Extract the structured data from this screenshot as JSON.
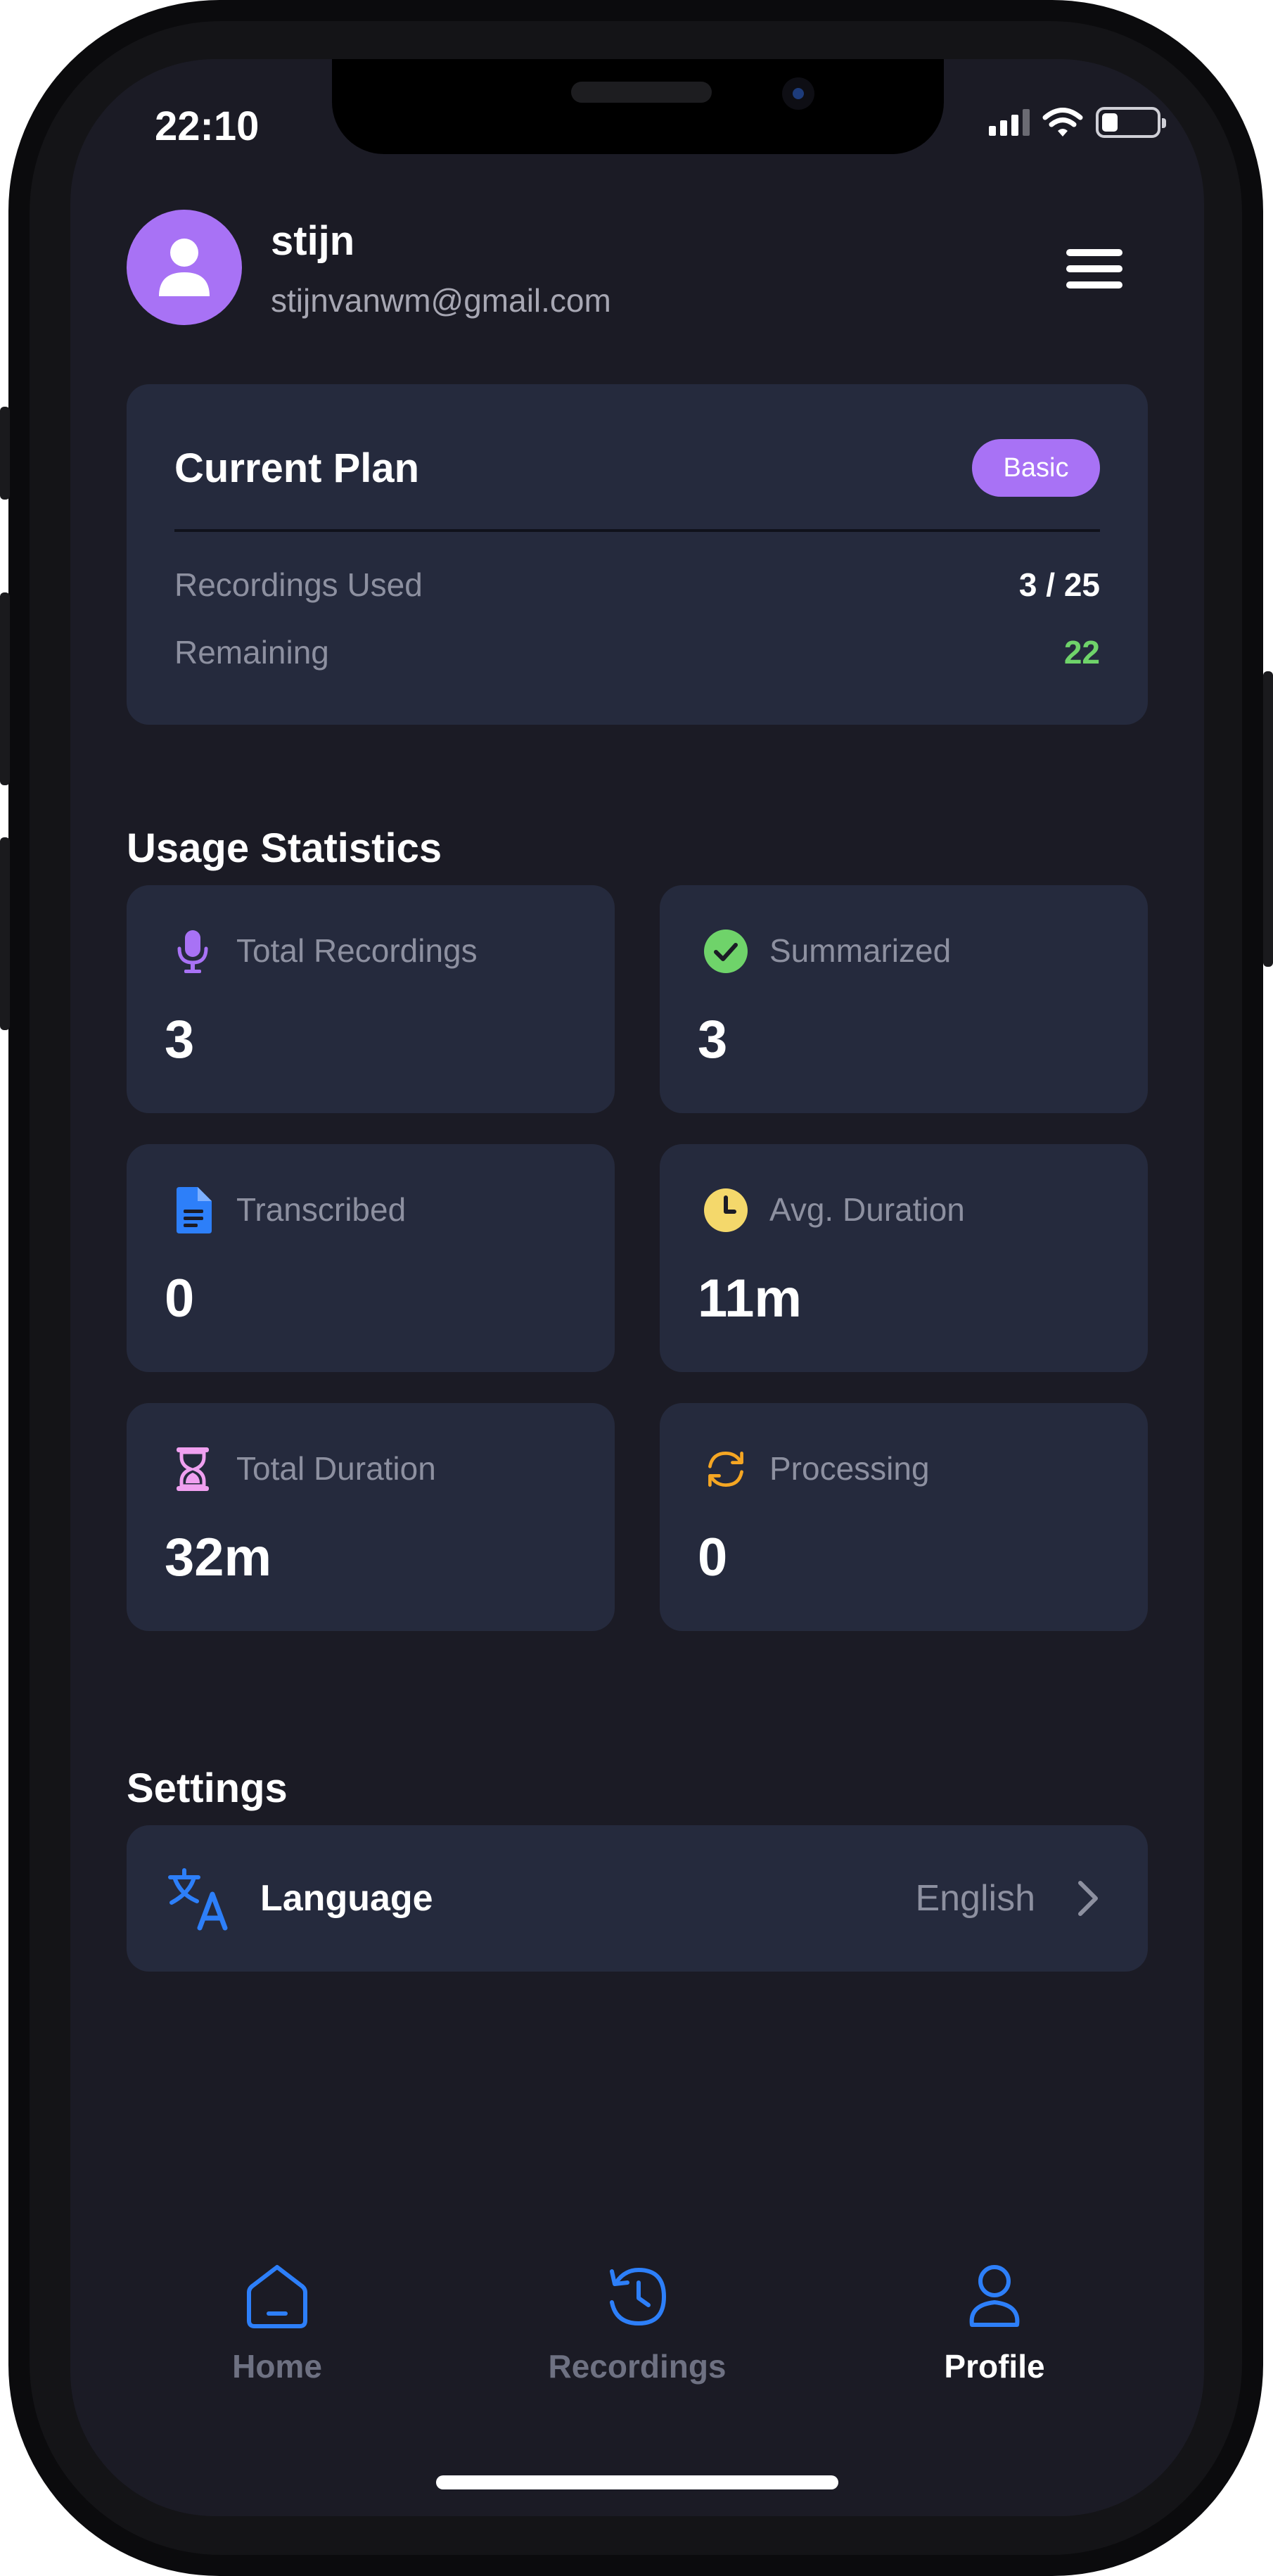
{
  "status_bar": {
    "time": "22:10"
  },
  "profile": {
    "name": "stijn",
    "email": "stijnvanwm@gmail.com"
  },
  "plan": {
    "title": "Current Plan",
    "badge": "Basic",
    "recordings_used_label": "Recordings Used",
    "recordings_used_value": "3 / 25",
    "remaining_label": "Remaining",
    "remaining_value": "22"
  },
  "usage": {
    "title": "Usage Statistics",
    "stats": [
      {
        "label": "Total Recordings",
        "value": "3",
        "icon": "microphone-icon"
      },
      {
        "label": "Summarized",
        "value": "3",
        "icon": "check-circle-icon"
      },
      {
        "label": "Transcribed",
        "value": "0",
        "icon": "document-icon"
      },
      {
        "label": "Avg. Duration",
        "value": "11m",
        "icon": "clock-icon"
      },
      {
        "label": "Total Duration",
        "value": "32m",
        "icon": "hourglass-icon"
      },
      {
        "label": "Processing",
        "value": "0",
        "icon": "refresh-icon"
      }
    ]
  },
  "settings": {
    "title": "Settings",
    "language_label": "Language",
    "language_value": "English"
  },
  "nav": {
    "items": [
      {
        "label": "Home",
        "icon": "home-icon",
        "active": false
      },
      {
        "label": "Recordings",
        "icon": "history-icon",
        "active": false
      },
      {
        "label": "Profile",
        "icon": "user-icon",
        "active": true
      }
    ]
  },
  "colors": {
    "background": "#1b1b25",
    "card": "#252a3d",
    "accent_purple": "#a872f5",
    "accent_blue": "#2d7ff9",
    "success_green": "#6fd36a",
    "muted_text": "#8d90a0"
  }
}
